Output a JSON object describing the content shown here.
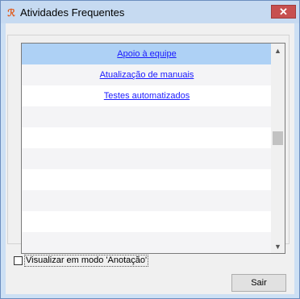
{
  "window": {
    "title": "Atividades Frequentes",
    "icon": "app-logo-icon",
    "close_glyph": "✕"
  },
  "list": {
    "items": [
      {
        "label": "Apoio à equipe",
        "selected": true
      },
      {
        "label": "Atualização de manuais",
        "selected": false
      },
      {
        "label": "Testes automatizados",
        "selected": false
      },
      {
        "label": "",
        "selected": false
      },
      {
        "label": "",
        "selected": false
      },
      {
        "label": "",
        "selected": false
      },
      {
        "label": "",
        "selected": false
      },
      {
        "label": "",
        "selected": false
      },
      {
        "label": "",
        "selected": false
      },
      {
        "label": "",
        "selected": false
      }
    ]
  },
  "scrollbar": {
    "up_glyph": "▲",
    "down_glyph": "▼"
  },
  "options": {
    "annotation_mode_label": "Visualizar em modo 'Anotação'",
    "annotation_mode_checked": false
  },
  "buttons": {
    "exit_label": "Sair"
  },
  "colors": {
    "selected_row": "#aed1f5",
    "link": "#1a1aff",
    "close_button": "#c75050",
    "titlebar": "#c6daf1"
  }
}
